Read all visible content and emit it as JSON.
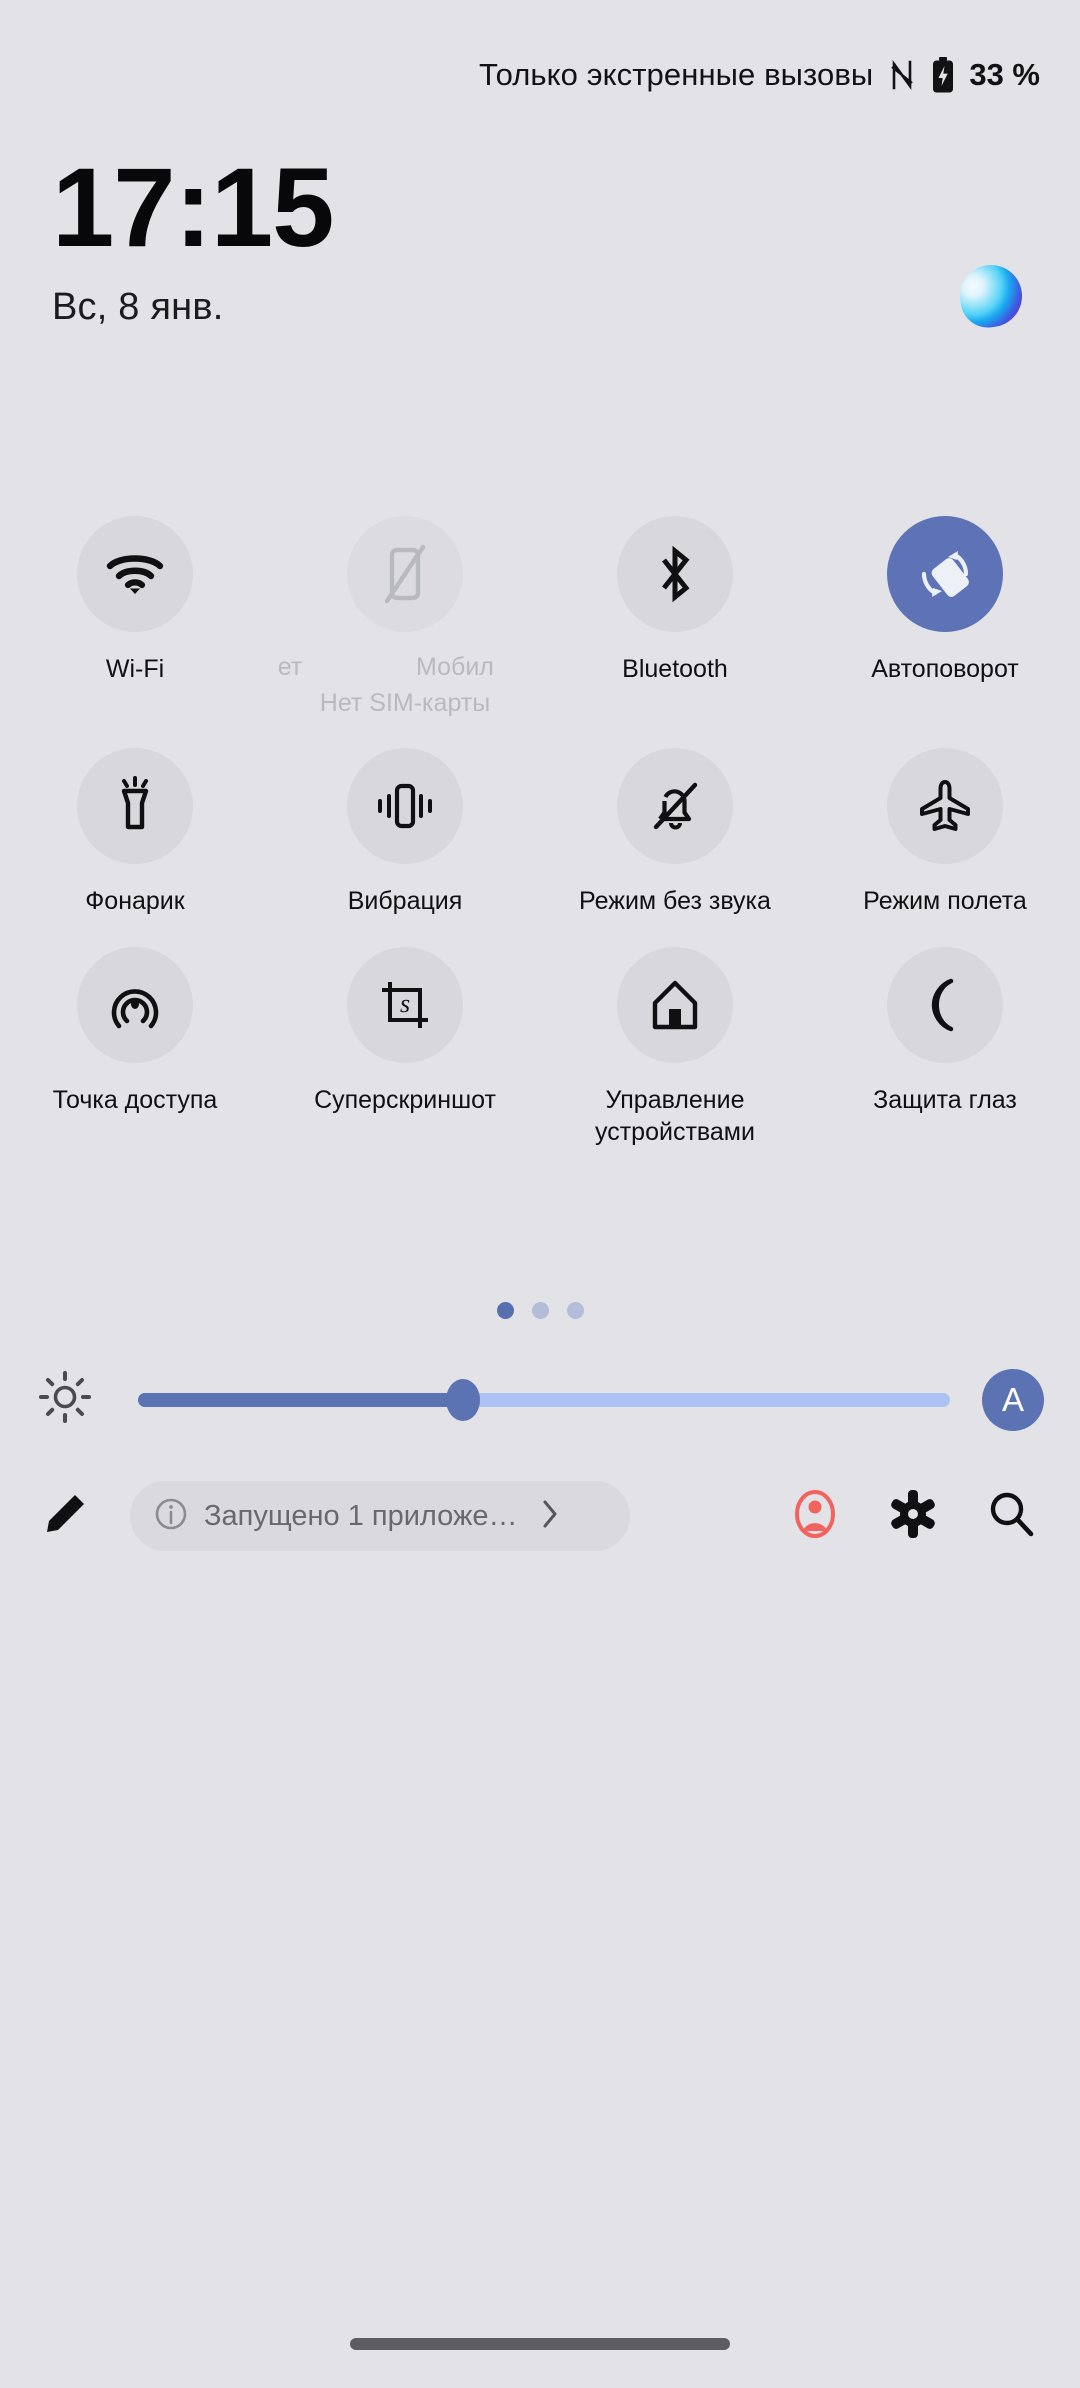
{
  "status_bar": {
    "carrier_text": "Только экстренные вызовы",
    "nfc_icon": "nfc-icon",
    "battery_icon": "battery-charging-icon",
    "battery_percent": "33 %"
  },
  "header": {
    "time": "17:15",
    "date": "Вс, 8 янв.",
    "brand_logo": "coloros-gradient-logo"
  },
  "quick_settings": {
    "rows": [
      {
        "tiles": [
          {
            "label": "Wi-Fi",
            "icon": "wifi-icon",
            "state": "off",
            "sub": ""
          },
          {
            "label_marquee_left": "онет",
            "label_marquee_right": "Мобил",
            "label": "Мобильный интернет",
            "icon": "mobile-data-off-icon",
            "state": "disabled",
            "sub": "Нет SIM-карты"
          },
          {
            "label": "Bluetooth",
            "icon": "bluetooth-icon",
            "state": "off",
            "sub": ""
          },
          {
            "label": "Автоповорот",
            "icon": "auto-rotate-icon",
            "state": "on",
            "sub": ""
          }
        ]
      },
      {
        "tiles": [
          {
            "label": "Фонарик",
            "icon": "flashlight-icon",
            "state": "off",
            "sub": ""
          },
          {
            "label": "Вибрация",
            "icon": "vibration-icon",
            "state": "off",
            "sub": ""
          },
          {
            "label": "Режим без звука",
            "icon": "bell-off-icon",
            "state": "off",
            "sub": ""
          },
          {
            "label": "Режим полета",
            "icon": "airplane-icon",
            "state": "off",
            "sub": ""
          }
        ]
      },
      {
        "tiles": [
          {
            "label": "Точка доступа",
            "icon": "hotspot-icon",
            "state": "off",
            "sub": ""
          },
          {
            "label": "Суперскриншот",
            "icon": "super-screenshot-icon",
            "state": "off",
            "sub": ""
          },
          {
            "label": "Управление устройствами",
            "icon": "device-control-home-icon",
            "state": "off",
            "sub": ""
          },
          {
            "label": "Защита глаз",
            "icon": "eye-comfort-moon-icon",
            "state": "off",
            "sub": ""
          }
        ]
      }
    ],
    "page_dots": {
      "count": 3,
      "active_index": 0
    }
  },
  "brightness": {
    "sun_icon": "brightness-sun-icon",
    "value_percent": 40,
    "auto_label": "A"
  },
  "toolbar": {
    "edit_icon": "edit-pencil-icon",
    "running_apps_chip": {
      "info_icon": "info-circle-icon",
      "text": "Запущено 1 приложе…",
      "chevron_icon": "chevron-right-icon"
    },
    "user_icon": "user-account-icon",
    "settings_icon": "gear-icon",
    "search_icon": "search-icon"
  },
  "colors": {
    "background": "#e3e3e7",
    "tile_off": "#d7d7dc",
    "tile_on": "#5d73b5",
    "accent": "#5b72b3",
    "user_red": "#f2635f",
    "dim_text": "#b9b9c0"
  },
  "navigation": {
    "home_indicator": "home-indicator"
  }
}
